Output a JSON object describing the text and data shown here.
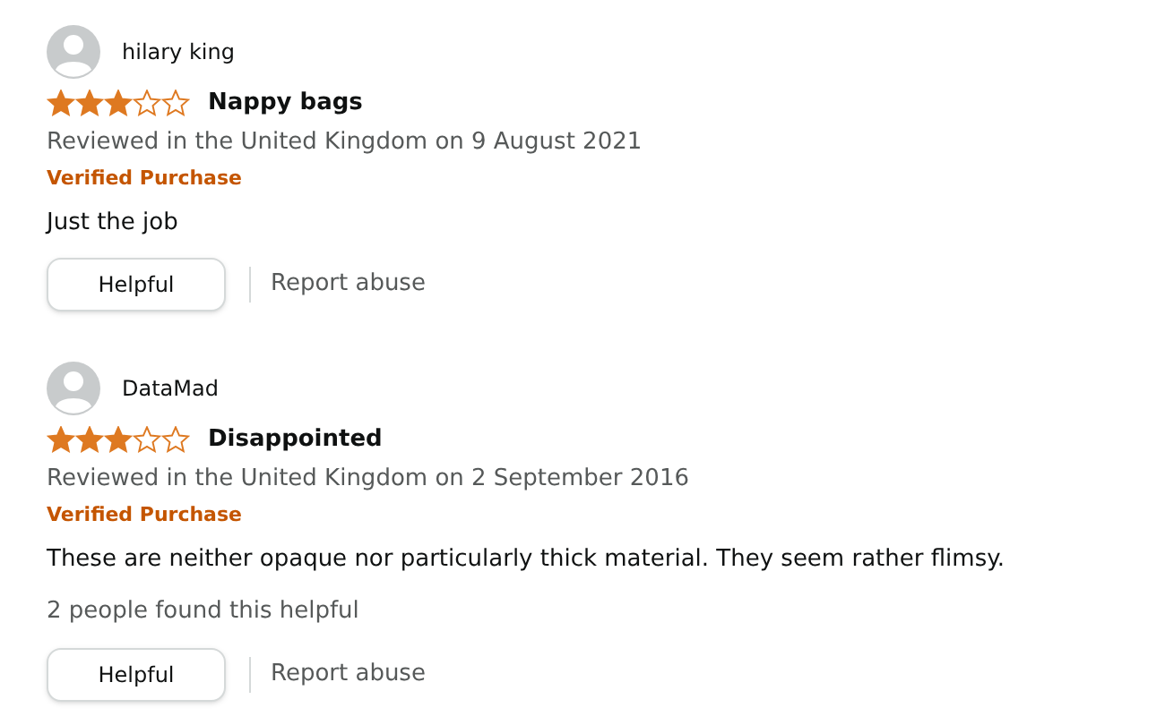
{
  "reviews": [
    {
      "author": "hilary king",
      "stars": 3,
      "title": "Nappy bags",
      "meta": "Reviewed in the United Kingdom on 9 August 2021",
      "badge": "Verified Purchase",
      "body": "Just the job",
      "helpful_button": "Helpful",
      "report": "Report abuse"
    },
    {
      "author": "DataMad",
      "stars": 3,
      "title": "Disappointed",
      "meta": "Reviewed in the United Kingdom on 2 September 2016",
      "badge": "Verified Purchase",
      "body": "These are neither opaque nor particularly thick material. They seem rather flimsy.",
      "helpful_count": "2 people found this helpful",
      "helpful_button": "Helpful",
      "report": "Report abuse"
    }
  ]
}
